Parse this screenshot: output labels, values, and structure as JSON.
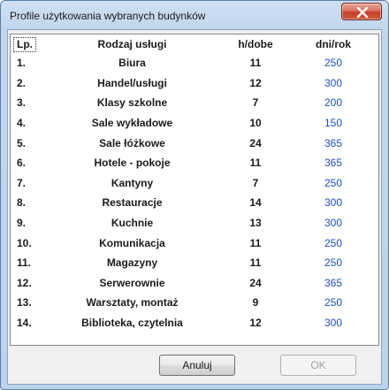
{
  "window": {
    "title": "Profile użytkowania wybranych budynków"
  },
  "table": {
    "headers": {
      "lp": "Lp.",
      "name": "Rodzaj usługi",
      "hours": "h/dobe",
      "days": "dni/rok"
    },
    "rows": [
      {
        "lp": "1.",
        "name": "Biura",
        "hours": "11",
        "days": "250"
      },
      {
        "lp": "2.",
        "name": "Handel/usługi",
        "hours": "12",
        "days": "300"
      },
      {
        "lp": "3.",
        "name": "Klasy szkolne",
        "hours": "7",
        "days": "200"
      },
      {
        "lp": "4.",
        "name": "Sale wykładowe",
        "hours": "10",
        "days": "150"
      },
      {
        "lp": "5.",
        "name": "Sale łóżkowe",
        "hours": "24",
        "days": "365"
      },
      {
        "lp": "6.",
        "name": "Hotele - pokoje",
        "hours": "11",
        "days": "365"
      },
      {
        "lp": "7.",
        "name": "Kantyny",
        "hours": "7",
        "days": "250"
      },
      {
        "lp": "8.",
        "name": "Restauracje",
        "hours": "14",
        "days": "300"
      },
      {
        "lp": "9.",
        "name": "Kuchnie",
        "hours": "13",
        "days": "300"
      },
      {
        "lp": "10.",
        "name": "Komunikacja",
        "hours": "11",
        "days": "250"
      },
      {
        "lp": "11.",
        "name": "Magazyny",
        "hours": "11",
        "days": "250"
      },
      {
        "lp": "12.",
        "name": "Serwerownie",
        "hours": "24",
        "days": "365"
      },
      {
        "lp": "13.",
        "name": "Warsztaty, montaż",
        "hours": "9",
        "days": "250"
      },
      {
        "lp": "14.",
        "name": "Biblioteka, czytelnia",
        "hours": "12",
        "days": "300"
      }
    ]
  },
  "buttons": {
    "cancel": "Anuluj",
    "ok": "OK"
  },
  "icons": {
    "close": "close-icon"
  },
  "colors": {
    "days_value": "#1f4fb8",
    "close_button": "#c2412a"
  }
}
